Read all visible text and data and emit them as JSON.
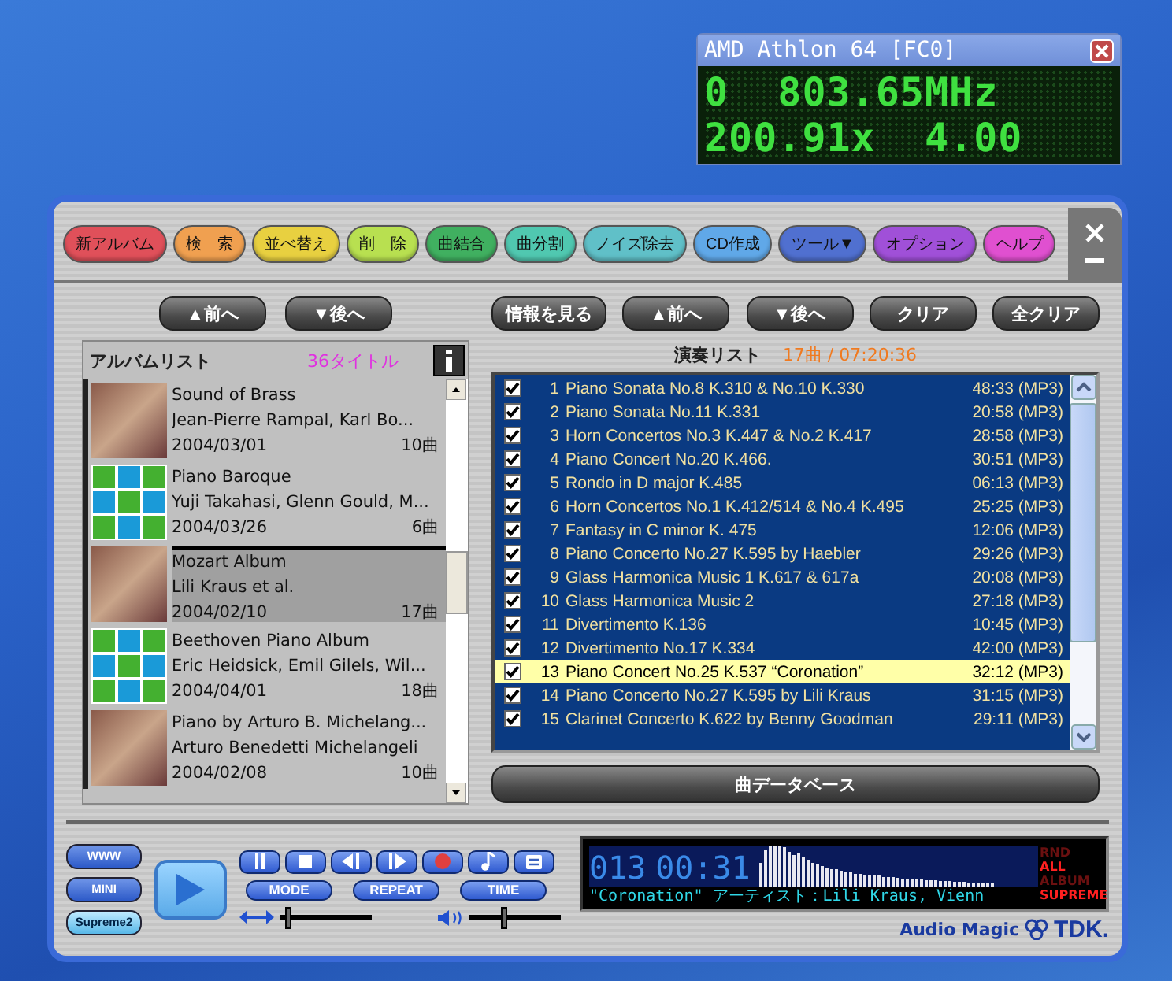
{
  "cpu_widget": {
    "title": "AMD Athlon 64 [FC0]",
    "lines": [
      "0  803.65MHz",
      "200.91x  4.00"
    ]
  },
  "toolbar": {
    "buttons": [
      {
        "label": "新アルバム",
        "color": "#e0505a"
      },
      {
        "label": "検　索",
        "color": "#f0a050"
      },
      {
        "label": "並べ替え",
        "color": "#e8d040"
      },
      {
        "label": "削　除",
        "color": "#b8e050"
      },
      {
        "label": "曲結合",
        "color": "#40b060"
      },
      {
        "label": "曲分割",
        "color": "#50c8b0"
      },
      {
        "label": "ノイズ除去",
        "color": "#60c0c8"
      },
      {
        "label": "CD作成",
        "color": "#60a8e8"
      },
      {
        "label": "ツール▼",
        "color": "#5070d0"
      },
      {
        "label": "オプション",
        "color": "#a050d8"
      },
      {
        "label": "ヘルプ",
        "color": "#e050d0"
      }
    ]
  },
  "album_panel": {
    "buttons": [
      "▲前へ",
      "▼後へ"
    ],
    "title": "アルバムリスト",
    "count": "36タイトル",
    "albums": [
      {
        "title": "Sound of Brass",
        "artist": "Jean-Pierre Rampal, Karl Bo...",
        "date": "2004/03/01",
        "tracks": "10曲",
        "kind": "photo",
        "selected": false
      },
      {
        "title": "Piano Baroque",
        "artist": "Yuji Takahasi, Glenn Gould, M...",
        "date": "2004/03/26",
        "tracks": "6曲",
        "kind": "pattern",
        "selected": false
      },
      {
        "title": "Mozart Album",
        "artist": "Lili Kraus et al.",
        "date": "2004/02/10",
        "tracks": "17曲",
        "kind": "photo",
        "selected": true
      },
      {
        "title": "Beethoven Piano Album",
        "artist": "Eric Heidsick, Emil Gilels, Wil...",
        "date": "2004/04/01",
        "tracks": "18曲",
        "kind": "pattern",
        "selected": false
      },
      {
        "title": "Piano by Arturo B. Michelang...",
        "artist": "Arturo Benedetti Michelangeli",
        "date": "2004/02/08",
        "tracks": "10曲",
        "kind": "photo",
        "selected": false
      }
    ]
  },
  "playlist_panel": {
    "buttons": [
      "情報を見る",
      "▲前へ",
      "▼後へ",
      "クリア",
      "全クリア"
    ],
    "title": "演奏リスト",
    "summary": "17曲 / 07:20:36",
    "tracks": [
      {
        "no": "1",
        "title": "Piano Sonata No.8 K.310 & No.10 K.330",
        "time": "48:33 (MP3)",
        "checked": true,
        "selected": false
      },
      {
        "no": "2",
        "title": "Piano Sonata No.11 K.331",
        "time": "20:58 (MP3)",
        "checked": true,
        "selected": false
      },
      {
        "no": "3",
        "title": "Horn Concertos No.3 K.447 & No.2 K.417",
        "time": "28:58 (MP3)",
        "checked": true,
        "selected": false
      },
      {
        "no": "4",
        "title": "Piano Concert No.20 K.466.",
        "time": "30:51 (MP3)",
        "checked": true,
        "selected": false
      },
      {
        "no": "5",
        "title": "Rondo in D major K.485",
        "time": "06:13 (MP3)",
        "checked": true,
        "selected": false
      },
      {
        "no": "6",
        "title": "Horn Concertos No.1 K.412/514 & No.4 K.495",
        "time": "25:25 (MP3)",
        "checked": true,
        "selected": false
      },
      {
        "no": "7",
        "title": "Fantasy in C minor K. 475",
        "time": "12:06 (MP3)",
        "checked": true,
        "selected": false
      },
      {
        "no": "8",
        "title": "Piano Concerto No.27 K.595 by Haebler",
        "time": "29:26 (MP3)",
        "checked": true,
        "selected": false
      },
      {
        "no": "9",
        "title": "Glass Harmonica Music 1 K.617 & 617a",
        "time": "20:08 (MP3)",
        "checked": true,
        "selected": false
      },
      {
        "no": "10",
        "title": "Glass Harmonica Music 2",
        "time": "27:18 (MP3)",
        "checked": true,
        "selected": false
      },
      {
        "no": "11",
        "title": "Divertimento K.136",
        "time": "10:45 (MP3)",
        "checked": true,
        "selected": false
      },
      {
        "no": "12",
        "title": "Divertimento No.17 K.334",
        "time": "42:00 (MP3)",
        "checked": true,
        "selected": false
      },
      {
        "no": "13",
        "title": "Piano Concert No.25 K.537 “Coronation”",
        "time": "32:12 (MP3)",
        "checked": true,
        "selected": true
      },
      {
        "no": "14",
        "title": "Piano Concerto No.27 K.595 by Lili Kraus",
        "time": "31:15 (MP3)",
        "checked": true,
        "selected": false
      },
      {
        "no": "15",
        "title": "Clarinet Concerto K.622 by Benny Goodman",
        "time": "29:11 (MP3)",
        "checked": true,
        "selected": false
      }
    ],
    "database_button": "曲データベース"
  },
  "controls": {
    "side_buttons": [
      {
        "label": "WWW",
        "selected": false
      },
      {
        "label": "MINI",
        "selected": false
      },
      {
        "label": "Supreme2",
        "selected": true
      }
    ],
    "mode_buttons": [
      "MODE",
      "REPEAT",
      "TIME"
    ],
    "balance": {
      "level": 0.05
    },
    "volume": {
      "level": 0.35
    }
  },
  "display": {
    "track": "013",
    "time": "00:31",
    "scroll_text": "\"Coronation\"   アーティスト：Lili Kraus, Vienn",
    "indicators": [
      {
        "label": "RND",
        "on": false
      },
      {
        "label": "ALL",
        "on": true
      },
      {
        "label": "ALBUM",
        "on": false
      },
      {
        "label": "SUPREME",
        "on": true
      }
    ]
  },
  "brand": {
    "product": "Audio Magic",
    "logo": "TDK."
  }
}
